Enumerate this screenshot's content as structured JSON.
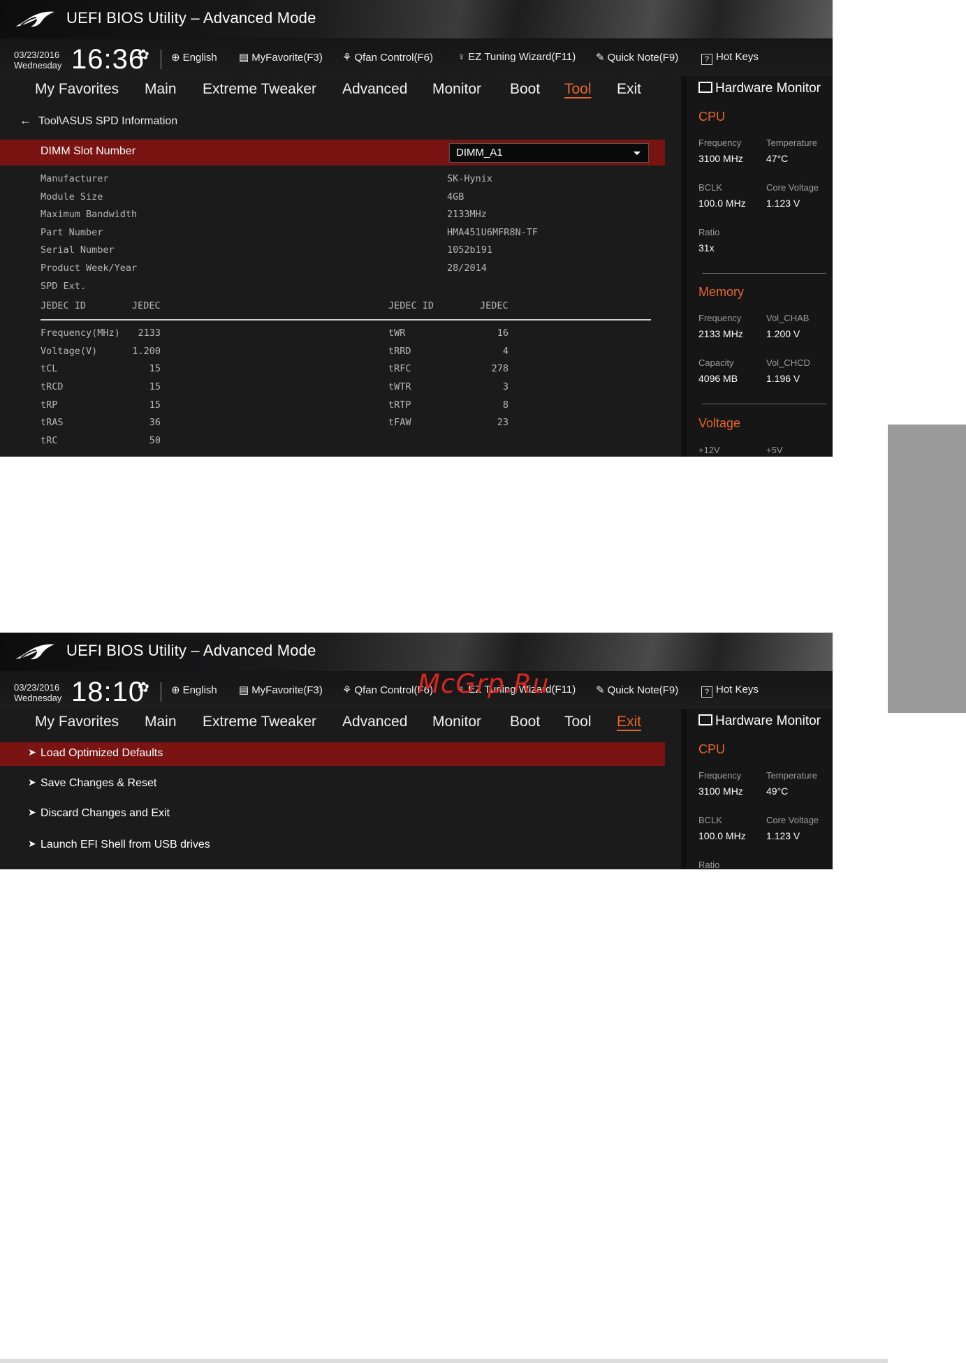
{
  "app_title": "UEFI BIOS Utility – Advanced Mode",
  "toolbar": {
    "language": "English",
    "myfavorite": "MyFavorite(F3)",
    "qfan": "Qfan Control(F6)",
    "ez_tuning": "EZ Tuning Wizard(F11)",
    "quick_note": "Quick Note(F9)",
    "hot_keys": "Hot Keys"
  },
  "menu": [
    "My Favorites",
    "Main",
    "Extreme Tweaker",
    "Advanced",
    "Monitor",
    "Boot",
    "Tool",
    "Exit"
  ],
  "hw_title": "Hardware Monitor",
  "screen1": {
    "date": "03/23/2016",
    "day": "Wednesday",
    "time": "16:36",
    "active_menu": "Tool",
    "breadcrumb": "Tool\\ASUS SPD Information",
    "dimm_label": "DIMM Slot Number",
    "dimm_value": "DIMM_A1",
    "info": [
      {
        "label": "Manufacturer",
        "value": "SK-Hynix"
      },
      {
        "label": "Module Size",
        "value": "4GB"
      },
      {
        "label": "Maximum Bandwidth",
        "value": "2133MHz"
      },
      {
        "label": "Part Number",
        "value": "HMA451U6MFR8N-TF"
      },
      {
        "label": "Serial Number",
        "value": "1052b191"
      },
      {
        "label": "Product Week/Year",
        "value": "28/2014"
      }
    ],
    "spd_ext": "SPD Ext.",
    "jedec_header": {
      "id": "JEDEC ID",
      "val": "JEDEC"
    },
    "left_timings": [
      {
        "name": "Frequency(MHz)",
        "value": "2133"
      },
      {
        "name": "Voltage(V)",
        "value": "1.200"
      },
      {
        "name": "tCL",
        "value": "15"
      },
      {
        "name": "tRCD",
        "value": "15"
      },
      {
        "name": "tRP",
        "value": "15"
      },
      {
        "name": "tRAS",
        "value": "36"
      },
      {
        "name": "tRC",
        "value": "50"
      }
    ],
    "right_timings": [
      {
        "name": "tWR",
        "value": "16"
      },
      {
        "name": "tRRD",
        "value": "4"
      },
      {
        "name": "tRFC",
        "value": "278"
      },
      {
        "name": "tWTR",
        "value": "3"
      },
      {
        "name": "tRTP",
        "value": "8"
      },
      {
        "name": "tFAW",
        "value": "23"
      }
    ],
    "hw": {
      "cpu_title": "CPU",
      "cpu": [
        {
          "label": "Frequency",
          "value": "3100 MHz"
        },
        {
          "label": "Temperature",
          "value": "47°C"
        },
        {
          "label": "BCLK",
          "value": "100.0 MHz"
        },
        {
          "label": "Core Voltage",
          "value": "1.123 V"
        },
        {
          "label": "Ratio",
          "value": "31x"
        }
      ],
      "mem_title": "Memory",
      "mem": [
        {
          "label": "Frequency",
          "value": "2133 MHz"
        },
        {
          "label": "Vol_CHAB",
          "value": "1.200 V"
        },
        {
          "label": "Capacity",
          "value": "4096 MB"
        },
        {
          "label": "Vol_CHCD",
          "value": "1.196 V"
        }
      ],
      "volt_title": "Voltage",
      "volt": [
        "+12V",
        "+5V"
      ]
    }
  },
  "screen2": {
    "date": "03/23/2016",
    "day": "Wednesday",
    "time": "18:10",
    "active_menu": "Exit",
    "items": [
      "Load Optimized Defaults",
      "Save Changes & Reset",
      "Discard Changes and Exit",
      "Launch EFI Shell from USB drives"
    ],
    "hw": {
      "cpu_title": "CPU",
      "cpu": [
        {
          "label": "Frequency",
          "value": "3100 MHz"
        },
        {
          "label": "Temperature",
          "value": "49°C"
        },
        {
          "label": "BCLK",
          "value": "100.0 MHz"
        },
        {
          "label": "Core Voltage",
          "value": "1.123 V"
        },
        {
          "label": "Ratio",
          "value": ""
        }
      ]
    }
  },
  "watermark": "McGrp.Ru",
  "colors": {
    "accent": "#e9662b",
    "highlight": "#7a1413",
    "background": "#1b1b1c"
  }
}
